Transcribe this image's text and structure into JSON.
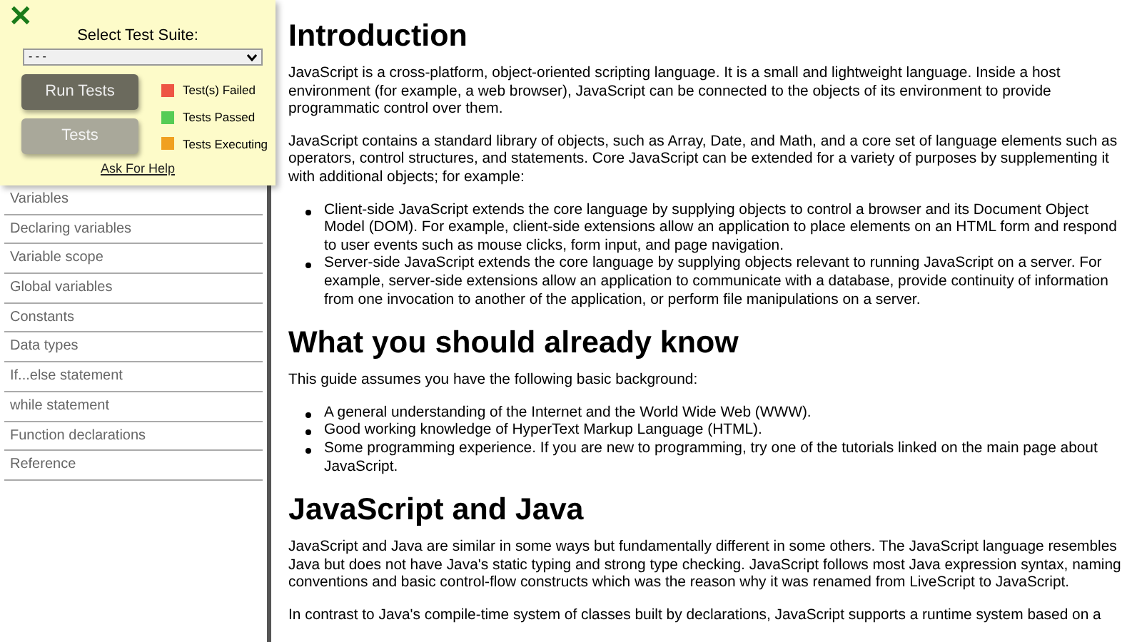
{
  "sidebar": {
    "items": [
      {
        "label": "Variables"
      },
      {
        "label": "Declaring variables"
      },
      {
        "label": "Variable scope"
      },
      {
        "label": "Global variables"
      },
      {
        "label": "Constants"
      },
      {
        "label": "Data types"
      },
      {
        "label": "If...else statement"
      },
      {
        "label": "while statement"
      },
      {
        "label": "Function declarations"
      },
      {
        "label": "Reference"
      }
    ]
  },
  "test_panel": {
    "close": "✕",
    "heading": "Select Test Suite:",
    "suite_select": {
      "value": "- - -"
    },
    "buttons": [
      {
        "label": "Run Tests",
        "kind": "primary"
      },
      {
        "label": "Tests",
        "kind": "secondary"
      }
    ],
    "legend": [
      {
        "label": "Test(s) Failed",
        "color": "#ee5544"
      },
      {
        "label": "Tests Passed",
        "color": "#55cc55"
      },
      {
        "label": "Tests Executing",
        "color": "#f0a020"
      }
    ],
    "help_link": "Ask For Help"
  },
  "content": [
    {
      "kind": "heading",
      "text": "Introduction"
    },
    {
      "kind": "paragraph",
      "text": "JavaScript is a cross-platform, object-oriented scripting language. It is a small and lightweight language. Inside a host environment (for example, a web browser), JavaScript can be connected to the objects of its environment to provide programmatic control over them."
    },
    {
      "kind": "paragraph",
      "text": "JavaScript contains a standard library of objects, such as Array, Date, and Math, and a core set of language elements such as operators, control structures, and statements. Core JavaScript can be extended for a variety of purposes by supplementing it with additional objects; for example:"
    },
    {
      "kind": "list",
      "items": [
        "Client-side JavaScript extends the core language by supplying objects to control a browser and its Document Object Model (DOM). For example, client-side extensions allow an application to place elements on an HTML form and respond to user events such as mouse clicks, form input, and page navigation.",
        "Server-side JavaScript extends the core language by supplying objects relevant to running JavaScript on a server. For example, server-side extensions allow an application to communicate with a database, provide continuity of information from one invocation to another of the application, or perform file manipulations on a server."
      ]
    },
    {
      "kind": "heading",
      "text": "What you should already know"
    },
    {
      "kind": "paragraph",
      "text": "This guide assumes you have the following basic background:"
    },
    {
      "kind": "list",
      "items": [
        "A general understanding of the Internet and the World Wide Web (WWW).",
        "Good working knowledge of HyperText Markup Language (HTML).",
        "Some programming experience. If you are new to programming, try one of the tutorials linked on the main page about JavaScript."
      ]
    },
    {
      "kind": "heading",
      "text": "JavaScript and Java"
    },
    {
      "kind": "paragraph",
      "text": "JavaScript and Java are similar in some ways but fundamentally different in some others. The JavaScript language resembles Java but does not have Java's static typing and strong type checking. JavaScript follows most Java expression syntax, naming conventions and basic control-flow constructs which was the reason why it was renamed from LiveScript to JavaScript."
    },
    {
      "kind": "paragraph",
      "text": "In contrast to Java's compile-time system of classes built by declarations, JavaScript supports a runtime system based on a"
    }
  ]
}
